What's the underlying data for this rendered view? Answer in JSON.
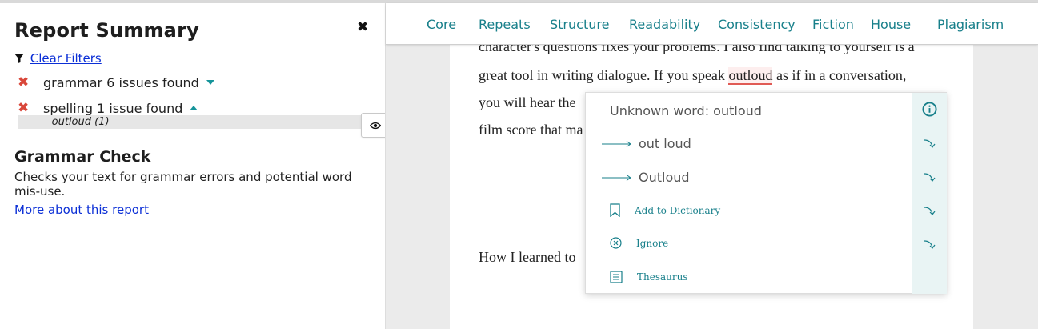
{
  "sidebar": {
    "title": "Report Summary",
    "close_glyph": "✖",
    "clear_filters": "Clear Filters",
    "issues": [
      {
        "label": "grammar 6 issues found",
        "expanded": false
      },
      {
        "label": "spelling 1 issue found",
        "expanded": true
      }
    ],
    "sub_item": "– outloud (1)",
    "report": {
      "title": "Grammar Check",
      "description": "Checks your text for grammar errors and potential word mis-use.",
      "link": "More about this report"
    }
  },
  "tabs": [
    "Core",
    "Repeats",
    "Structure",
    "Readability",
    "Consistency",
    "Fiction",
    "House",
    "Plagiarism"
  ],
  "document": {
    "line1": "character's questions fixes your problems. I also find talking to yourself is a",
    "line2_before": "great tool in writing dialogue. If you speak ",
    "line2_word": "outloud",
    "line2_after": " as if in a conversation,",
    "line3": "you will hear the",
    "line4": "film score that ma",
    "line5": "How I learned to"
  },
  "popup": {
    "title": "Unknown word: outloud",
    "suggestions": [
      "out loud",
      "Outloud"
    ],
    "actions": [
      "Add to Dictionary",
      "Ignore",
      "Thesaurus"
    ]
  },
  "colors": {
    "accent": "#177f8a",
    "error": "#d9473a",
    "link": "#0b2fd6"
  }
}
